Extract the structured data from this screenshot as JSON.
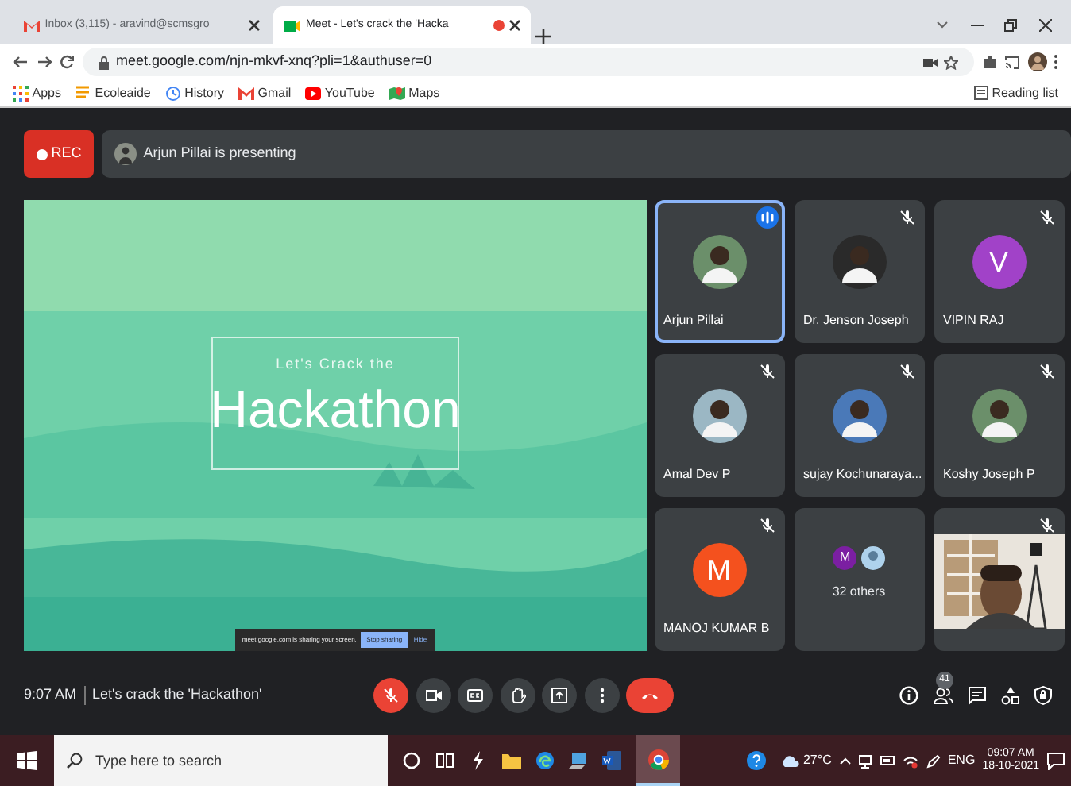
{
  "browser": {
    "tabs": [
      {
        "title": "Inbox (3,115) - aravind@scmsgro",
        "kind": "mail",
        "selected": false
      },
      {
        "title": "Meet - Let's crack the 'Hacka",
        "kind": "meet",
        "selected": true
      }
    ],
    "url": "meet.google.com/njn-mkvf-xnq?pli=1&authuser=0",
    "bookmarks": [
      {
        "label": "Apps",
        "kind": "apps"
      },
      {
        "label": "Ecoleaide",
        "kind": "doc"
      },
      {
        "label": "History",
        "kind": "history"
      },
      {
        "label": "Gmail",
        "kind": "mail"
      },
      {
        "label": "YouTube",
        "kind": "youtube"
      },
      {
        "label": "Maps",
        "kind": "maps"
      }
    ],
    "reading_list": "Reading list"
  },
  "meet": {
    "rec": "REC",
    "presenting": "Arjun Pillai is presenting",
    "slide": {
      "subtitle": "Let's Crack the",
      "title": "Hackathon",
      "share_text": "meet.google.com is sharing your screen.",
      "stop": "Stop sharing",
      "hide": "Hide"
    },
    "tiles": [
      {
        "name": "Arjun Pillai",
        "muted": false,
        "speaking": true
      },
      {
        "name": "Dr. Jenson Joseph",
        "muted": true,
        "speaking": false
      },
      {
        "name": "VIPIN RAJ",
        "kind": "initial",
        "initial": "V",
        "color": "#a142c8",
        "muted": true,
        "speaking": false
      },
      {
        "name": "Amal Dev P",
        "muted": true,
        "speaking": false
      },
      {
        "name": "sujay Kochunaraya...",
        "muted": true,
        "speaking": false
      },
      {
        "name": "Koshy Joseph P",
        "muted": true,
        "speaking": false
      },
      {
        "name": "MANOJ KUMAR B",
        "kind": "initial",
        "initial": "M",
        "color": "#f4511e",
        "muted": true,
        "speaking": false
      },
      {
        "name": "32 others",
        "kind": "others",
        "initial": "M",
        "color": "#7b1fa2",
        "muted": false,
        "speaking": false
      },
      {
        "kind": "camera",
        "muted": true,
        "speaking": false
      }
    ],
    "time": "9:07 AM",
    "meeting_title": "Let's crack the 'Hackathon'",
    "mic_muted": true,
    "people_count": "41"
  },
  "taskbar": {
    "search_placeholder": "Type here to search",
    "temperature": "27°C",
    "language": "ENG",
    "time": "09:07 AM",
    "date": "18-10-2021"
  }
}
